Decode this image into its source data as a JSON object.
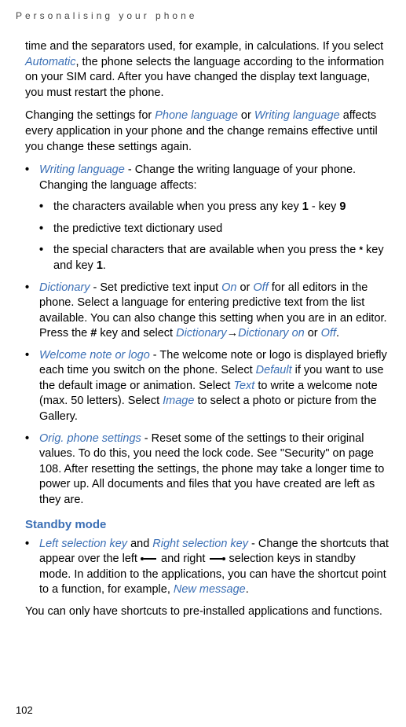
{
  "header": "Personalising your phone",
  "page_number": "102",
  "p1": {
    "text1": "time and the separators used, for example, in calculations. If you select ",
    "automatic": "Automatic",
    "text2": ", the phone selects the language according to the information on your SIM card. After you have changed the display text language, you must restart the phone."
  },
  "p2": {
    "text1": "Changing the settings for ",
    "phone_lang": "Phone language",
    "text2": " or ",
    "writing_lang": "Writing language",
    "text3": " affects every application in your phone and the change remains effective until you change these settings again."
  },
  "b1": {
    "writing_lang": "Writing language",
    "text1": " - Change the writing language of your phone. Changing the language affects:"
  },
  "sb1": {
    "text1": "the characters available when you press any key ",
    "key1": "1",
    "text2": " - key ",
    "key9": "9"
  },
  "sb2": "the predictive text dictionary used",
  "sb3": {
    "text1": "the special characters that are available when you press the ",
    "star": "*",
    "text2": " key and key ",
    "key1": "1",
    "text3": "."
  },
  "b2": {
    "dictionary": "Dictionary",
    "text1": " - Set predictive text input ",
    "on": "On",
    "text2": " or ",
    "off": "Off",
    "text3": " for all editors in the phone. Select a language for entering predictive text from the list available. You can also change this setting when you are in an editor. Press the ",
    "hash": "#",
    "text4": " key and select ",
    "dict2": "Dictionary",
    "arrow": "→",
    "dict_on": "Dictionary on",
    "text5": " or ",
    "off2": "Off",
    "text6": "."
  },
  "b3": {
    "welcome": "Welcome note or logo",
    "text1": " - The welcome note or logo is displayed briefly each time you switch on the phone. Select ",
    "default": "Default",
    "text2": " if you want to use the default image or animation. Select ",
    "text_opt": "Text",
    "text3": " to write a welcome note (max. 50 letters). Select ",
    "image": "Image",
    "text4": " to select a photo or picture from the Gallery."
  },
  "b4": {
    "orig": "Orig. phone settings",
    "text1": " - Reset some of the settings to their original values. To do this, you need the lock code. See \"Security\" on page 108. After resetting the settings, the phone may take a longer time to power up. All documents and files that you have created are left as they are."
  },
  "standby_heading": "Standby mode",
  "b5": {
    "left_sel": "Left selection key",
    "text1": " and ",
    "right_sel": "Right selection key",
    "text2": " - Change the shortcuts that appear over the left ",
    "text3": " and right ",
    "text4": " selection keys in standby mode. In addition to the applications, you can have the shortcut point to a function, for example, ",
    "new_msg": "New message",
    "text5": "."
  },
  "p_final": "You can only have shortcuts to pre-installed applications and functions."
}
